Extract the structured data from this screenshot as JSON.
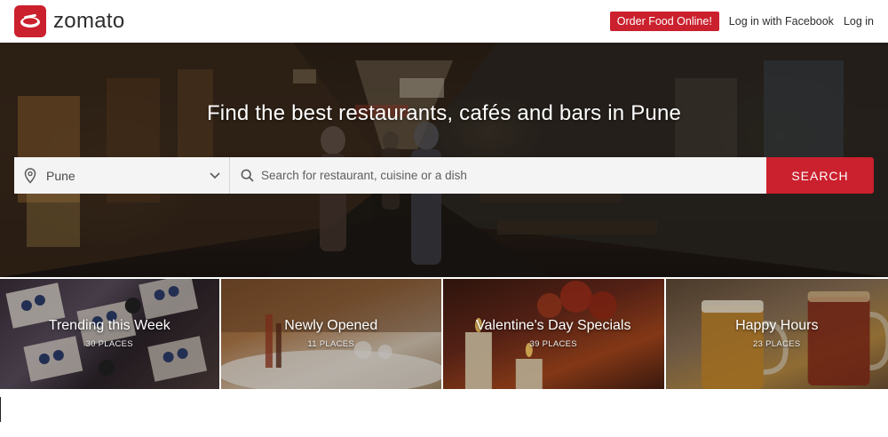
{
  "brand": {
    "name": "zomato",
    "color": "#cb202d"
  },
  "nav": {
    "order_button": "Order Food Online!",
    "facebook_login": "Log in with Facebook",
    "login": "Log in"
  },
  "hero": {
    "title": "Find the best restaurants, cafés and bars in Pune",
    "location": {
      "value": "Pune",
      "icon": "location-pin-icon"
    },
    "search": {
      "placeholder": "Search for restaurant, cuisine or a dish",
      "icon": "search-icon",
      "button_label": "SEARCH"
    }
  },
  "collections": [
    {
      "title": "Trending this Week",
      "count": "30 PLACES"
    },
    {
      "title": "Newly Opened",
      "count": "11 PLACES"
    },
    {
      "title": "Valentine's Day Specials",
      "count": "39 PLACES"
    },
    {
      "title": "Happy Hours",
      "count": "23 PLACES"
    }
  ]
}
